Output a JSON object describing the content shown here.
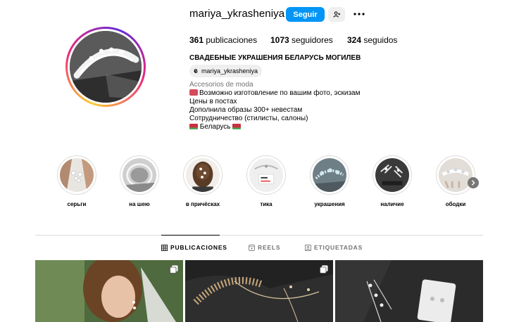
{
  "profile": {
    "username": "mariya_ykrasheniya",
    "follow_label": "Seguir",
    "stats": {
      "posts_count": "361",
      "posts_label": "publicaciones",
      "followers_count": "1073",
      "followers_label": "seguidores",
      "following_count": "324",
      "following_label": "seguidos"
    },
    "bio_title": "СВАДЕБНЫЕ УКРАШЕНИЯ БЕЛАРУСЬ МОГИЛЕВ",
    "threads_handle": "mariya_ykrasheniya",
    "category": "Accesorios de moda",
    "bio_lines": {
      "l1": "Возможно изготовление по вашим фото, эскизам",
      "l2": "Цены в постах",
      "l3": "Дополнила образы 300+ невестам",
      "l4": "Сотрудничество (стилисты, салоны)",
      "l5": "Беларусь"
    }
  },
  "highlights": [
    {
      "label": "серьги"
    },
    {
      "label": "на шею"
    },
    {
      "label": "в причёсках"
    },
    {
      "label": "тика"
    },
    {
      "label": "украшения"
    },
    {
      "label": "наличие"
    },
    {
      "label": "ободки"
    }
  ],
  "tabs": {
    "posts": "PUBLICACIONES",
    "reels": "REELS",
    "tagged": "ETIQUETADAS"
  },
  "icons": {
    "follow_suggest": "person-plus-icon",
    "more": "more-dots-icon",
    "threads": "threads-icon",
    "grid": "grid-icon",
    "reels": "reels-icon",
    "tagged": "tagged-icon",
    "carousel": "carousel-icon",
    "next": "chevron-right-icon"
  },
  "colors": {
    "accent": "#0095f6",
    "muted_text": "#737373",
    "divider": "#dbdbdb"
  }
}
